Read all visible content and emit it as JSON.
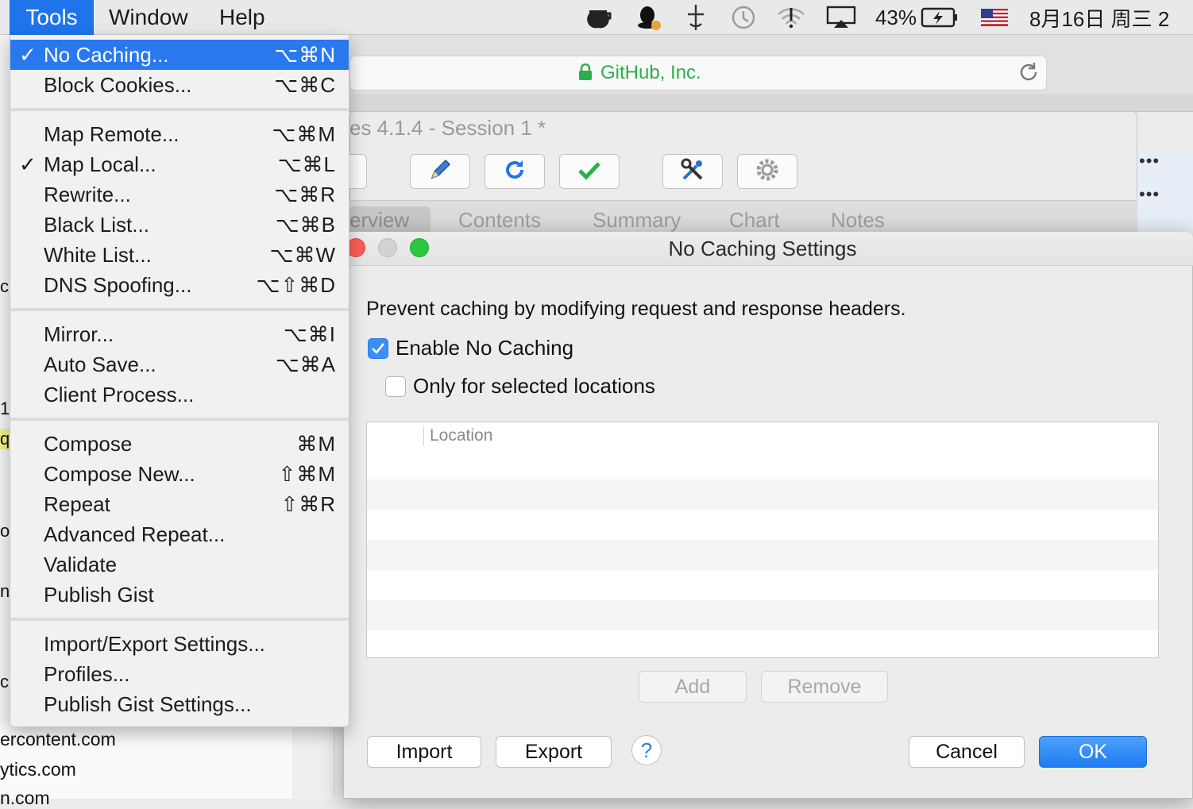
{
  "menubar": {
    "items": [
      "Tools",
      "Window",
      "Help"
    ],
    "battery": "43%",
    "datetime": "8月16日 周三 2"
  },
  "browser": {
    "url_label": "GitHub, Inc."
  },
  "charles": {
    "title": "es 4.1.4 - Session 1 *",
    "tabs": [
      "erview",
      "Contents",
      "Summary",
      "Chart",
      "Notes"
    ],
    "toolbar_icons": [
      "pen-icon",
      "refresh-icon",
      "check-icon",
      "tools-icon",
      "gear-icon"
    ]
  },
  "background_text": {
    "hosts": [
      "ercontent.com",
      "ytics.com",
      "n.com"
    ],
    "fragments": [
      "c",
      "1.",
      "q.",
      "or",
      "n",
      "c"
    ],
    "ellipsis": [
      "•••",
      "•••"
    ]
  },
  "menu": {
    "groups": [
      [
        {
          "label": "No Caching...",
          "shortcut": "⌥⌘N",
          "checked": true,
          "selected": true
        },
        {
          "label": "Block Cookies...",
          "shortcut": "⌥⌘C"
        }
      ],
      [
        {
          "label": "Map Remote...",
          "shortcut": "⌥⌘M"
        },
        {
          "label": "Map Local...",
          "shortcut": "⌥⌘L",
          "checked": true
        },
        {
          "label": "Rewrite...",
          "shortcut": "⌥⌘R"
        },
        {
          "label": "Black List...",
          "shortcut": "⌥⌘B"
        },
        {
          "label": "White List...",
          "shortcut": "⌥⌘W"
        },
        {
          "label": "DNS Spoofing...",
          "shortcut": "⌥⇧⌘D"
        }
      ],
      [
        {
          "label": "Mirror...",
          "shortcut": "⌥⌘I"
        },
        {
          "label": "Auto Save...",
          "shortcut": "⌥⌘A"
        },
        {
          "label": "Client Process...",
          "shortcut": ""
        }
      ],
      [
        {
          "label": "Compose",
          "shortcut": "⌘M"
        },
        {
          "label": "Compose New...",
          "shortcut": "⇧⌘M"
        },
        {
          "label": "Repeat",
          "shortcut": "⇧⌘R"
        },
        {
          "label": "Advanced Repeat...",
          "shortcut": ""
        },
        {
          "label": "Validate",
          "shortcut": ""
        },
        {
          "label": "Publish Gist",
          "shortcut": ""
        }
      ],
      [
        {
          "label": "Import/Export Settings...",
          "shortcut": ""
        },
        {
          "label": "Profiles...",
          "shortcut": ""
        },
        {
          "label": "Publish Gist Settings...",
          "shortcut": ""
        }
      ]
    ]
  },
  "dialog": {
    "title": "No Caching Settings",
    "description": "Prevent caching by modifying request and response headers.",
    "enable_label": "Enable No Caching",
    "enable_checked": true,
    "only_selected_label": "Only for selected locations",
    "only_selected_checked": false,
    "table_header": "Location",
    "rows": [],
    "add_label": "Add",
    "remove_label": "Remove",
    "import_label": "Import",
    "export_label": "Export",
    "help_label": "?",
    "cancel_label": "Cancel",
    "ok_label": "OK"
  },
  "colors": {
    "accent": "#1f74ec",
    "url_green": "#2bae4b",
    "traffic_red": "#fc5f57",
    "traffic_gray": "#d2d2d2",
    "traffic_green": "#2ac73f"
  }
}
